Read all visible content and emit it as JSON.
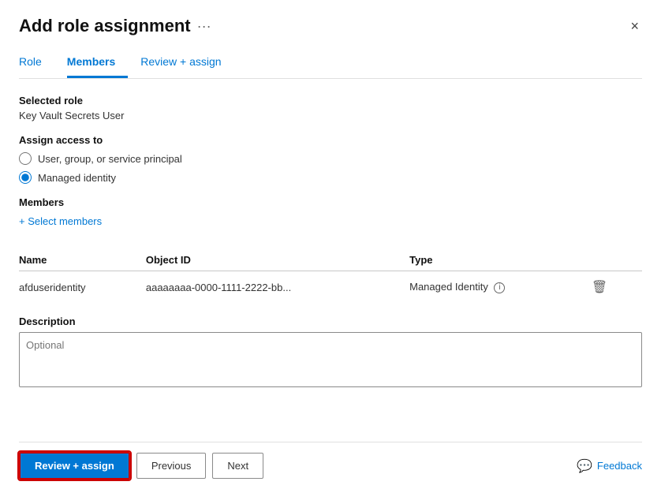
{
  "dialog": {
    "title": "Add role assignment",
    "more_icon": "···",
    "close_label": "×"
  },
  "tabs": [
    {
      "id": "role",
      "label": "Role",
      "active": false
    },
    {
      "id": "members",
      "label": "Members",
      "active": true
    },
    {
      "id": "review",
      "label": "Review + assign",
      "active": false
    }
  ],
  "selected_role": {
    "label": "Selected role",
    "value": "Key Vault Secrets User"
  },
  "assign_access": {
    "label": "Assign access to",
    "options": [
      {
        "id": "user-group",
        "label": "User, group, or service principal",
        "checked": false
      },
      {
        "id": "managed-identity",
        "label": "Managed identity",
        "checked": true
      }
    ]
  },
  "members": {
    "label": "Members",
    "select_link": "+ Select members",
    "columns": [
      "Name",
      "Object ID",
      "Type"
    ],
    "rows": [
      {
        "name": "afduseridentity",
        "object_id": "aaaaaaaa-0000-1111-2222-bb...",
        "type": "Managed Identity"
      }
    ]
  },
  "description": {
    "label": "Description",
    "placeholder": "Optional"
  },
  "footer": {
    "review_assign_label": "Review + assign",
    "previous_label": "Previous",
    "next_label": "Next",
    "feedback_label": "Feedback"
  }
}
